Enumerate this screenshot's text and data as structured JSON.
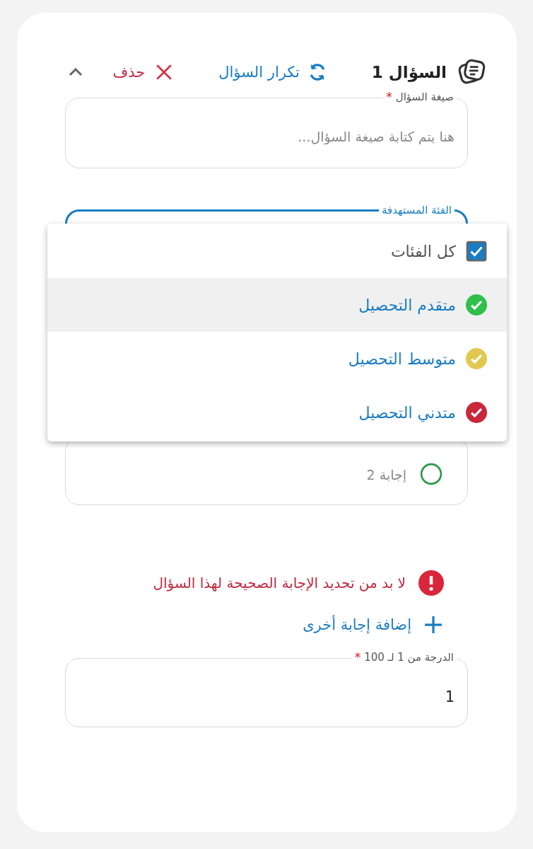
{
  "question": {
    "title": "السؤال 1",
    "repeat_label": "تكرار السؤال",
    "delete_label": "حذف",
    "expanded": true
  },
  "question_text": {
    "label": "صيغة السؤال",
    "required_mark": "*",
    "placeholder": "هنا يتم كتابة صيغة السؤال..."
  },
  "target_category": {
    "label": "الفئة المستهدفة",
    "focused": true,
    "options": [
      {
        "kind": "all",
        "label": "كل الفئات",
        "checked": true,
        "highlighted": false
      },
      {
        "kind": "level",
        "label": "متقدم التحصيل",
        "color": "#2fbf4a",
        "highlighted": true
      },
      {
        "kind": "level",
        "label": "متوسط التحصيل",
        "color": "#e2c84f",
        "highlighted": false
      },
      {
        "kind": "level",
        "label": "متدني التحصيل",
        "color": "#c8283a",
        "highlighted": false
      }
    ]
  },
  "answers": [
    {
      "placeholder": "إجابة 2",
      "correct": false
    }
  ],
  "error": "لا بد من تحديد الإجابة الصحيحة لهذا السؤال",
  "add_answer": "إضافة إجابة أخرى",
  "grade": {
    "label": "الدرجة من 1 لـ 100",
    "required_mark": "*",
    "value": "1"
  }
}
